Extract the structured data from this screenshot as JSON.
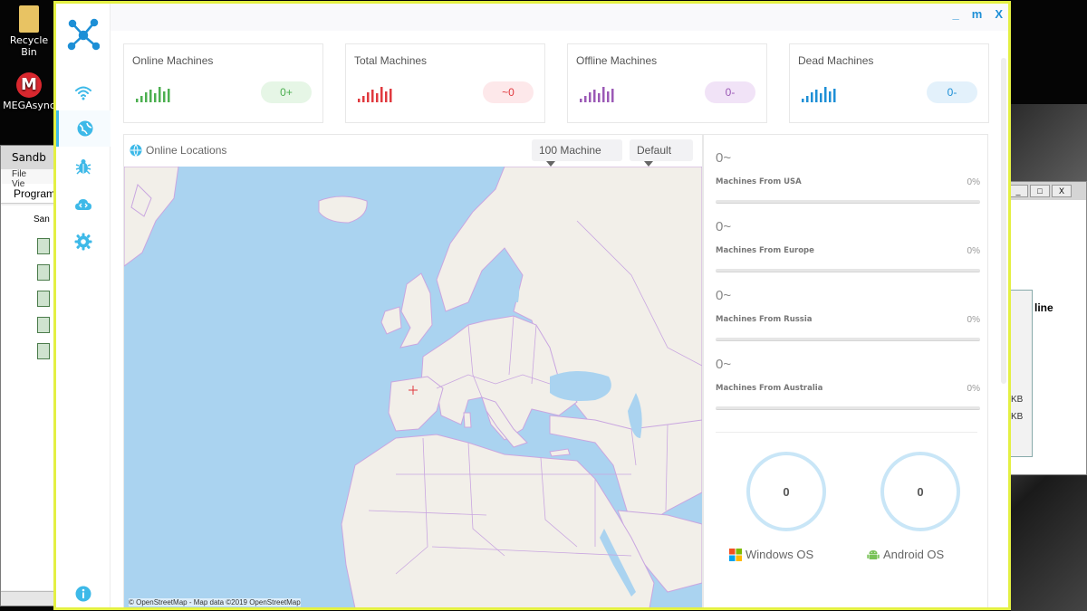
{
  "desktop": {
    "icons": [
      {
        "label": "Recycle Bin"
      },
      {
        "label": "MEGAsync"
      }
    ],
    "sandbox_window": {
      "title": "Sandb",
      "menu": [
        "File",
        "Vie"
      ],
      "header": "Program",
      "tree_label": "San"
    },
    "background_window": {
      "label": "line",
      "sizes": [
        "KB",
        "KB"
      ],
      "buttons": [
        "_",
        "□",
        "X"
      ]
    }
  },
  "app": {
    "window_controls": {
      "minimize": "_",
      "maximize": "m",
      "close": "X"
    },
    "sidebar": {
      "items": [
        {
          "icon": "wifi-icon"
        },
        {
          "icon": "globe-icon",
          "active": true
        },
        {
          "icon": "bug-icon"
        },
        {
          "icon": "cloud-code-icon"
        },
        {
          "icon": "gear-icon"
        },
        {
          "icon": "info-icon"
        }
      ]
    },
    "stats": [
      {
        "title": "Online Machines",
        "value": "0+",
        "color": "#4caf50",
        "badge_bg": "#e6f6e6"
      },
      {
        "title": "Total Machines",
        "value": "~0",
        "color": "#e0393e",
        "badge_bg": "#fde8ea"
      },
      {
        "title": "Offline Machines",
        "value": "0-",
        "color": "#9b59b6",
        "badge_bg": "#f1e3f7"
      },
      {
        "title": "Dead Machines",
        "value": "0-",
        "color": "#1d8fd6",
        "badge_bg": "#e3f1fb"
      }
    ],
    "map": {
      "title": "Online Locations",
      "machines_dropdown": "100 Machine",
      "style_dropdown": "Default",
      "attribution": "© OpenStreetMap - Map data ©2019 OpenStreetMap"
    },
    "regions": [
      {
        "count": "0~",
        "label": "Machines From USA",
        "percent": "0%",
        "fill": 0
      },
      {
        "count": "0~",
        "label": "Machines From Europe",
        "percent": "0%",
        "fill": 0
      },
      {
        "count": "0~",
        "label": "Machines From Russia",
        "percent": "0%",
        "fill": 0
      },
      {
        "count": "0~",
        "label": "Machines From Australia",
        "percent": "0%",
        "fill": 0
      }
    ],
    "os": [
      {
        "name": "Windows OS",
        "count": "0",
        "icon": "windows-icon"
      },
      {
        "name": "Android OS",
        "count": "0",
        "icon": "android-icon"
      }
    ],
    "colors": {
      "accent": "#3db9e8",
      "frame": "#e4f043",
      "ocean": "#aad3f0",
      "land": "#f2efe9",
      "borders": "#c9a6e0"
    }
  }
}
